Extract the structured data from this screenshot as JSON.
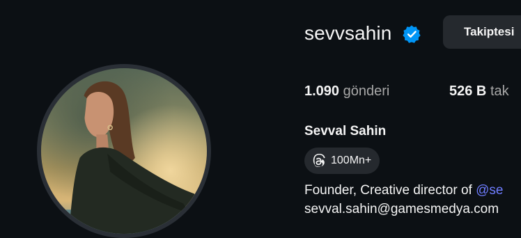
{
  "profile": {
    "username": "sevvsahin",
    "verified": true,
    "follow_button_label": "Takiptesi",
    "full_name": "Sevval Sahin",
    "stats": {
      "posts_count": "1.090",
      "posts_label": "gönderi",
      "followers_count": "526 B",
      "followers_label": "tak"
    },
    "threads_badge": {
      "icon": "threads-icon",
      "count": "100Mn+"
    },
    "bio": {
      "line1_text": "Founder, Creative director of ",
      "line1_mention": "@se",
      "line2_text": "sevval.sahin@gamesmedya.com"
    }
  },
  "colors": {
    "background": "#0c1014",
    "button_bg": "#25292e",
    "verified_blue": "#0095f6",
    "mention_link": "#6f7dff",
    "secondary_text": "#a8a8a8"
  }
}
